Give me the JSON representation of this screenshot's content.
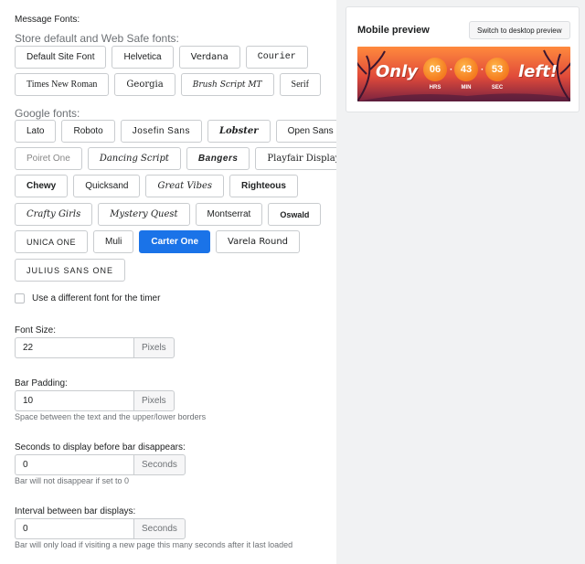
{
  "settings": {
    "message_fonts_title": "Message Fonts:",
    "web_safe_title": "Store default and Web Safe fonts:",
    "web_safe_rows": [
      [
        "Default Site Font",
        "Helvetica",
        "Verdana",
        "Courier"
      ],
      [
        "Times New Roman",
        "Georgia",
        "Brush Script MT",
        "Serif"
      ]
    ],
    "google_title": "Google fonts:",
    "google_rows": [
      [
        "Lato",
        "Roboto",
        "Josefin Sans",
        "Lobster",
        "Open Sans"
      ],
      [
        "Poiret One",
        "Dancing Script",
        "Bangers",
        "Playfair Display"
      ],
      [
        "Chewy",
        "Quicksand",
        "Great Vibes",
        "Righteous"
      ],
      [
        "Crafty Girls",
        "Mystery Quest",
        "Montserrat",
        "Oswald"
      ],
      [
        "UNICA ONE",
        "Muli",
        "Carter One",
        "Varela Round"
      ],
      [
        "JULIUS SANS ONE"
      ]
    ],
    "selected_font": "Carter One",
    "timer_font_checkbox": {
      "label": "Use a different font for the timer",
      "checked": false
    },
    "font_size": {
      "label": "Font Size:",
      "value": "22",
      "unit": "Pixels"
    },
    "bar_padding": {
      "label": "Bar Padding:",
      "value": "10",
      "unit": "Pixels",
      "help": "Space between the text and the upper/lower borders"
    },
    "seconds_before_disappear": {
      "label": "Seconds to display before bar disappears:",
      "value": "0",
      "unit": "Seconds",
      "help": "Bar will not disappear if set to 0"
    },
    "interval": {
      "label": "Interval between bar displays:",
      "value": "0",
      "unit": "Seconds",
      "help": "Bar will only load if visiting a new page this many seconds after it last loaded"
    }
  },
  "preview": {
    "title": "Mobile preview",
    "switch_label": "Switch to desktop preview",
    "bar": {
      "before_text": "Only",
      "after_text": "left!",
      "hours": "06",
      "hours_label": "HRS",
      "minutes": "43",
      "minutes_label": "MIN",
      "seconds": "53",
      "seconds_label": "SEC"
    }
  },
  "colors": {
    "selected": "#1a73e8",
    "bar_top": "#ff8a3d",
    "bar_bottom": "#7b2340"
  }
}
